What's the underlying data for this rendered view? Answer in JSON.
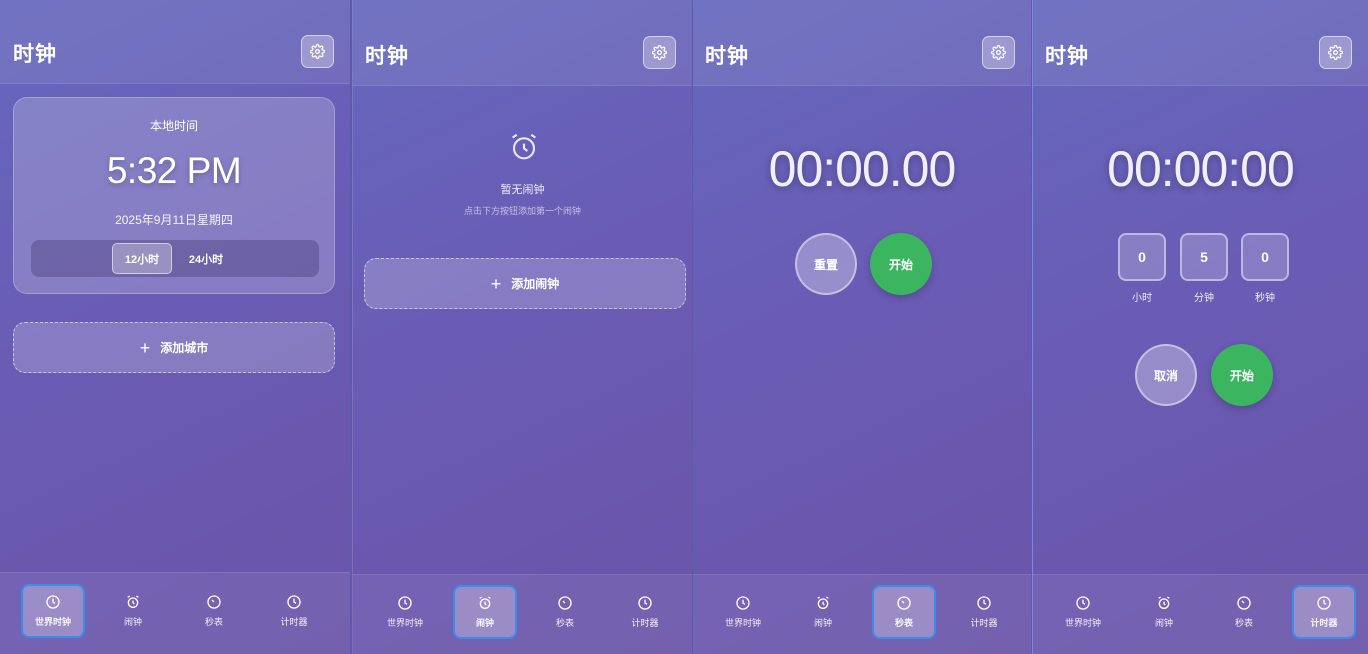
{
  "app": {
    "title": "时钟"
  },
  "nav": {
    "world": "世界时钟",
    "alarm": "闹钟",
    "stopwatch": "秒表",
    "timer": "计时器"
  },
  "world_clock": {
    "label": "本地时间",
    "time": "5:32 PM",
    "date": "2025年9月11日星期四",
    "format_12": "12小时",
    "format_24": "24小时",
    "selected_format": "12小时",
    "add_city": "添加城市"
  },
  "alarm": {
    "empty_title": "暂无闹钟",
    "empty_subtitle": "点击下方按钮添加第一个闹钟",
    "add_alarm": "添加闹钟"
  },
  "stopwatch": {
    "display": "00:00.00",
    "reset": "重置",
    "start": "开始"
  },
  "timer": {
    "display": "00:00:00",
    "hours": "0",
    "minutes": "5",
    "seconds": "0",
    "hours_label": "小时",
    "minutes_label": "分钟",
    "seconds_label": "秒钟",
    "cancel": "取消",
    "start": "开始"
  },
  "icons": {
    "settings": "gear-icon",
    "world": "clock-icon",
    "alarm": "alarm-clock-icon",
    "stopwatch": "stopwatch-icon",
    "timer": "timer-icon"
  },
  "colors": {
    "accent_green": "#3cb561",
    "nav_active_border": "#3a8cf0"
  }
}
